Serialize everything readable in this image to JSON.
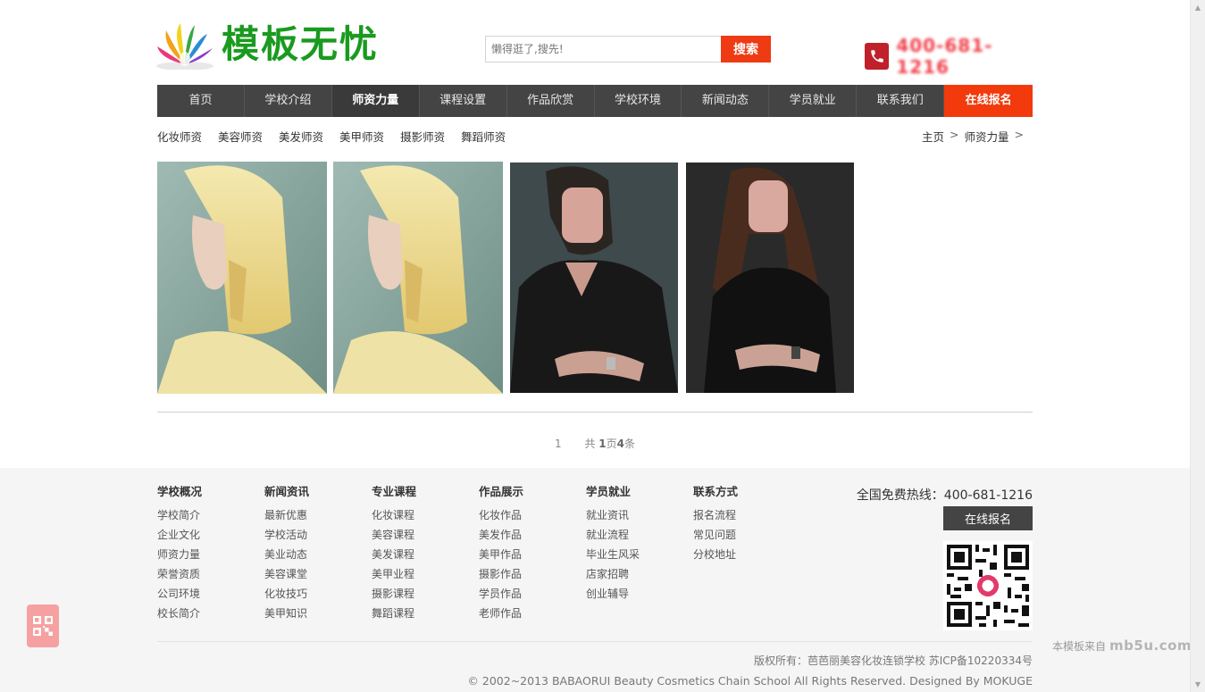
{
  "header": {
    "logo_text": "模板无忧",
    "search_placeholder": "懒得逛了,搜先!",
    "search_button": "搜索",
    "phone_number": "400-681-1216"
  },
  "nav": {
    "items": [
      "首页",
      "学校介绍",
      "师资力量",
      "课程设置",
      "作品欣赏",
      "学校环境",
      "新闻动态",
      "学员就业",
      "联系我们"
    ],
    "active": "师资力量",
    "cta": "在线报名"
  },
  "subnav": {
    "items": [
      "化妆师资",
      "美容师资",
      "美发师资",
      "美甲师资",
      "摄影师资",
      "舞蹈师资"
    ]
  },
  "breadcrumb": {
    "home": "主页",
    "current": "师资力量",
    "separator": ">"
  },
  "pager": {
    "page": "1",
    "prefix": "共",
    "pages": "1",
    "mid": "页",
    "count": "4",
    "suffix": "条"
  },
  "footer": {
    "columns": [
      {
        "title": "学校概况",
        "links": [
          "学校简介",
          "企业文化",
          "师资力量",
          "荣誉资质",
          "公司环境",
          "校长简介"
        ]
      },
      {
        "title": "新闻资讯",
        "links": [
          "最新优惠",
          "学校活动",
          "美业动态",
          "美容课堂",
          "化妆技巧",
          "美甲知识"
        ]
      },
      {
        "title": "专业课程",
        "links": [
          "化妆课程",
          "美容课程",
          "美发课程",
          "美甲业程",
          "摄影课程",
          "舞蹈课程"
        ]
      },
      {
        "title": "作品展示",
        "links": [
          "化妆作品",
          "美发作品",
          "美甲作品",
          "摄影作品",
          "学员作品",
          "老师作品"
        ]
      },
      {
        "title": "学员就业",
        "links": [
          "就业资讯",
          "就业流程",
          "毕业生风采",
          "店家招聘",
          "创业辅导"
        ]
      },
      {
        "title": "联系方式",
        "links": [
          "报名流程",
          "常见问题",
          "分校地址"
        ]
      }
    ],
    "hotline": "全国免费热线：400-681-1216",
    "signup": "在线报名",
    "copyright_1": "版权所有：芭芭丽美容化妆连锁学校 苏ICP备10220334号",
    "copyright_2": "© 2002~2013 BABAORUI Beauty Cosmetics Chain School All Rights Reserved. Designed By MOKUGE"
  },
  "watermark": {
    "text": "本模板来自",
    "logo": "mb5u.com"
  },
  "colors": {
    "accent": "#f23a0c",
    "nav_bg": "#444444",
    "logo_green": "#1a9a1f"
  }
}
